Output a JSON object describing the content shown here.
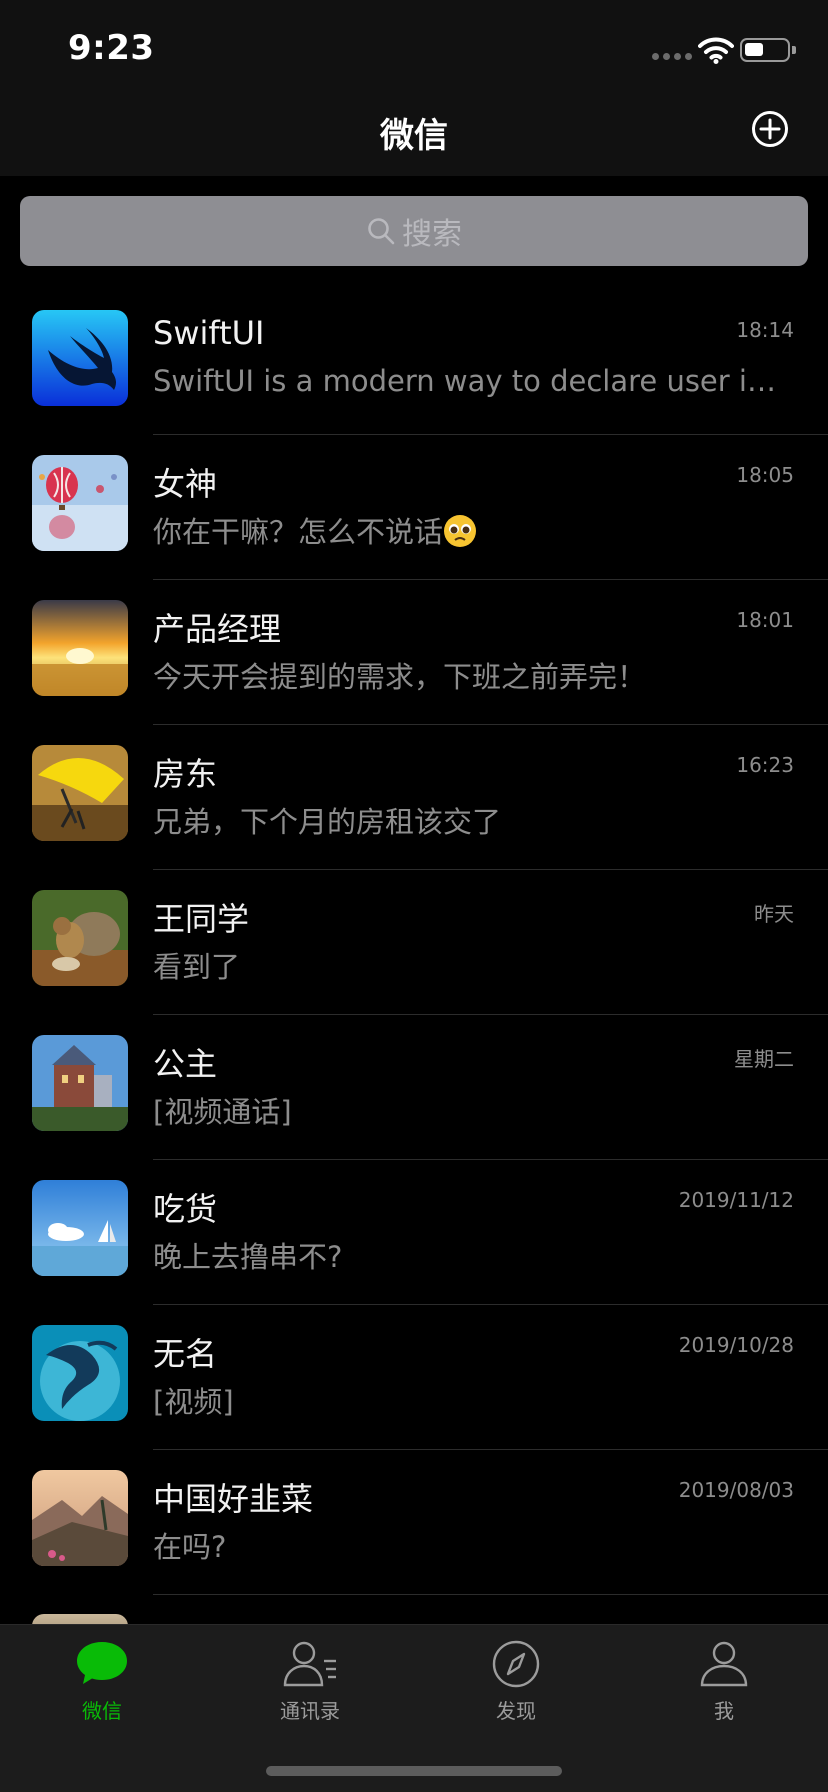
{
  "status_bar": {
    "time": "9:23",
    "battery_level": 0.45
  },
  "nav": {
    "title": "微信",
    "add_icon": "plus-circle-icon"
  },
  "search": {
    "placeholder": "搜索",
    "icon": "search-icon"
  },
  "chats": [
    {
      "name": "SwiftUI",
      "message": "SwiftUI is a modern way to declare user interfaces for any Apple platform.",
      "time": "18:14",
      "avatar": "swiftui-logo"
    },
    {
      "name": "女神",
      "message": "你在干嘛？怎么不说话",
      "emoji": "pleading-face",
      "time": "18:05",
      "avatar": "hot-air-balloons"
    },
    {
      "name": "产品经理",
      "message": "今天开会提到的需求，下班之前弄完！",
      "time": "18:01",
      "avatar": "sunset-field"
    },
    {
      "name": "房东",
      "message": "兄弟，下个月的房租该交了",
      "time": "16:23",
      "avatar": "yellow-umbrella"
    },
    {
      "name": "王同学",
      "message": "看到了",
      "time": "昨天",
      "avatar": "squirrel"
    },
    {
      "name": "公主",
      "message": "[视频通话]",
      "time": "星期二",
      "avatar": "castle"
    },
    {
      "name": "吃货",
      "message": "晚上去撸串不?",
      "time": "2019/11/12",
      "avatar": "sailboat-sky"
    },
    {
      "name": "无名",
      "message": "[视频]",
      "time": "2019/10/28",
      "avatar": "blue-dragon"
    },
    {
      "name": "中国好韭菜",
      "message": "在吗?",
      "time": "2019/08/03",
      "avatar": "valley-landscape"
    }
  ],
  "tabs": [
    {
      "label": "微信",
      "icon": "chat-bubble-icon",
      "active": true
    },
    {
      "label": "通讯录",
      "icon": "contacts-icon",
      "active": false
    },
    {
      "label": "发现",
      "icon": "compass-icon",
      "active": false
    },
    {
      "label": "我",
      "icon": "person-icon",
      "active": false
    }
  ],
  "colors": {
    "accent": "#09bb07",
    "background": "#000000",
    "bar": "#111111",
    "secondary_text": "#8d8d8d"
  }
}
